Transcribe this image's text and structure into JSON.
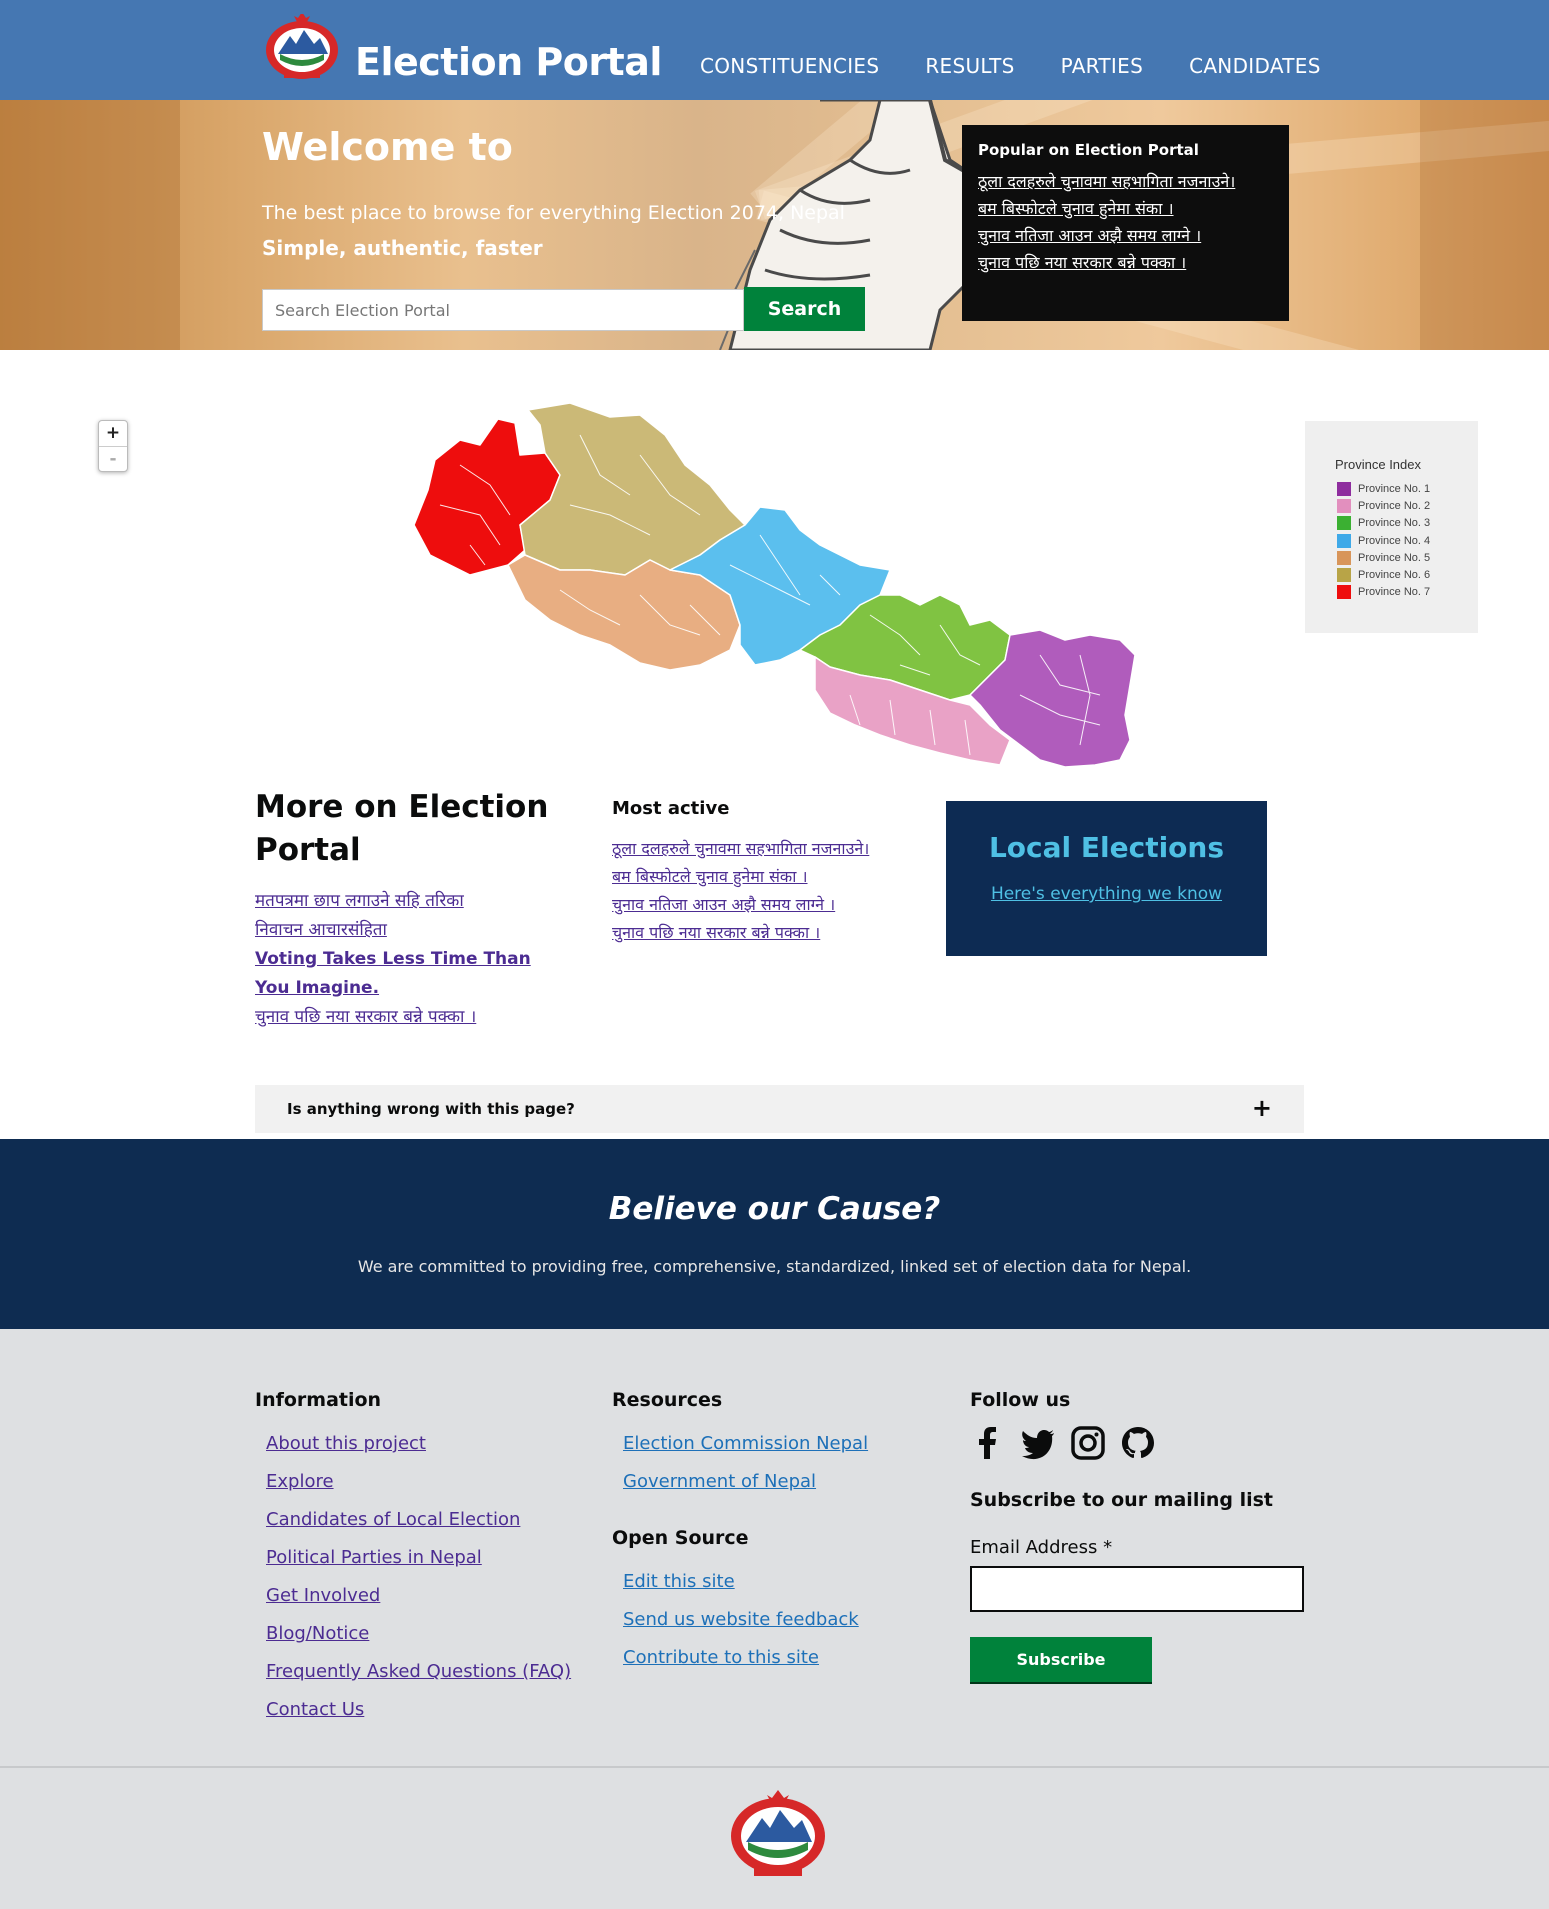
{
  "header": {
    "brand": "Election Portal",
    "nav": [
      "CONSTITUENCIES",
      "RESULTS",
      "PARTIES",
      "CANDIDATES"
    ]
  },
  "hero": {
    "title": "Welcome to",
    "subtitle": "The best place to browse for everything Election 2074, Nepal",
    "tagline": "Simple, authentic, faster",
    "search_placeholder": "Search Election Portal",
    "search_button": "Search"
  },
  "popular": {
    "title": "Popular on Election Portal",
    "links": [
      "ठूला दलहरुले चुनावमा सहभागिता नजनाउने।",
      "बम बिस्फोटले चुनाव हुनेमा संका ।",
      "चुनाव नतिजा आउन अझै समय लाग्ने ।",
      "चुनाव पछि नया सरकार बन्ने पक्का ।"
    ]
  },
  "map": {
    "zoom_in": "+",
    "zoom_out": "-",
    "legend_title": "Province Index",
    "legend": [
      {
        "label": "Province No. 1",
        "color": "#8e2d9e"
      },
      {
        "label": "Province No. 2",
        "color": "#e28fbe"
      },
      {
        "label": "Province No. 3",
        "color": "#3bb032"
      },
      {
        "label": "Province No. 4",
        "color": "#3fa9e8"
      },
      {
        "label": "Province No. 5",
        "color": "#d8955a"
      },
      {
        "label": "Province No. 6",
        "color": "#b8a447"
      },
      {
        "label": "Province No. 7",
        "color": "#ee0d0d"
      }
    ]
  },
  "more": {
    "title": "More on Election Portal",
    "links": [
      "मतपत्रमा छाप लगाउने सहि तरिका",
      "निवाचन आचारसंहिता",
      "Voting Takes Less Time Than You Imagine.",
      "चुनाव पछि नया सरकार बन्ने पक्का ।"
    ]
  },
  "most_active": {
    "title": "Most active",
    "links": [
      "ठूला दलहरुले चुनावमा सहभागिता नजनाउने।",
      "बम बिस्फोटले चुनाव हुनेमा संका ।",
      "चुनाव नतिजा आउन अझै समय लाग्ने ।",
      "चुनाव पछि नया सरकार बन्ने पक्का ।"
    ]
  },
  "local": {
    "title": "Local Elections",
    "link": "Here's everything we know"
  },
  "feedback": {
    "label": "Is anything wrong with this page?",
    "toggle": "+"
  },
  "cause": {
    "title": "Believe our Cause?",
    "text": "We are committed to providing free, comprehensive, standardized, linked set of election data for Nepal."
  },
  "footer": {
    "information": {
      "title": "Information",
      "links": [
        "About this project",
        "Explore",
        "Candidates of Local Election",
        "Political Parties in Nepal",
        "Get Involved",
        "Blog/Notice",
        "Frequently Asked Questions (FAQ)",
        "Contact Us"
      ]
    },
    "resources": {
      "title": "Resources",
      "links": [
        "Election Commission Nepal",
        "Government of Nepal"
      ]
    },
    "open_source": {
      "title": "Open Source",
      "links": [
        "Edit this site",
        "Send us website feedback",
        "Contribute to this site"
      ]
    },
    "follow": {
      "title": "Follow us",
      "icons": [
        "facebook-icon",
        "twitter-icon",
        "instagram-icon",
        "github-icon"
      ]
    },
    "mailing": {
      "title": "Subscribe to our mailing list",
      "email_label": "Email Address *",
      "button": "Subscribe"
    }
  }
}
